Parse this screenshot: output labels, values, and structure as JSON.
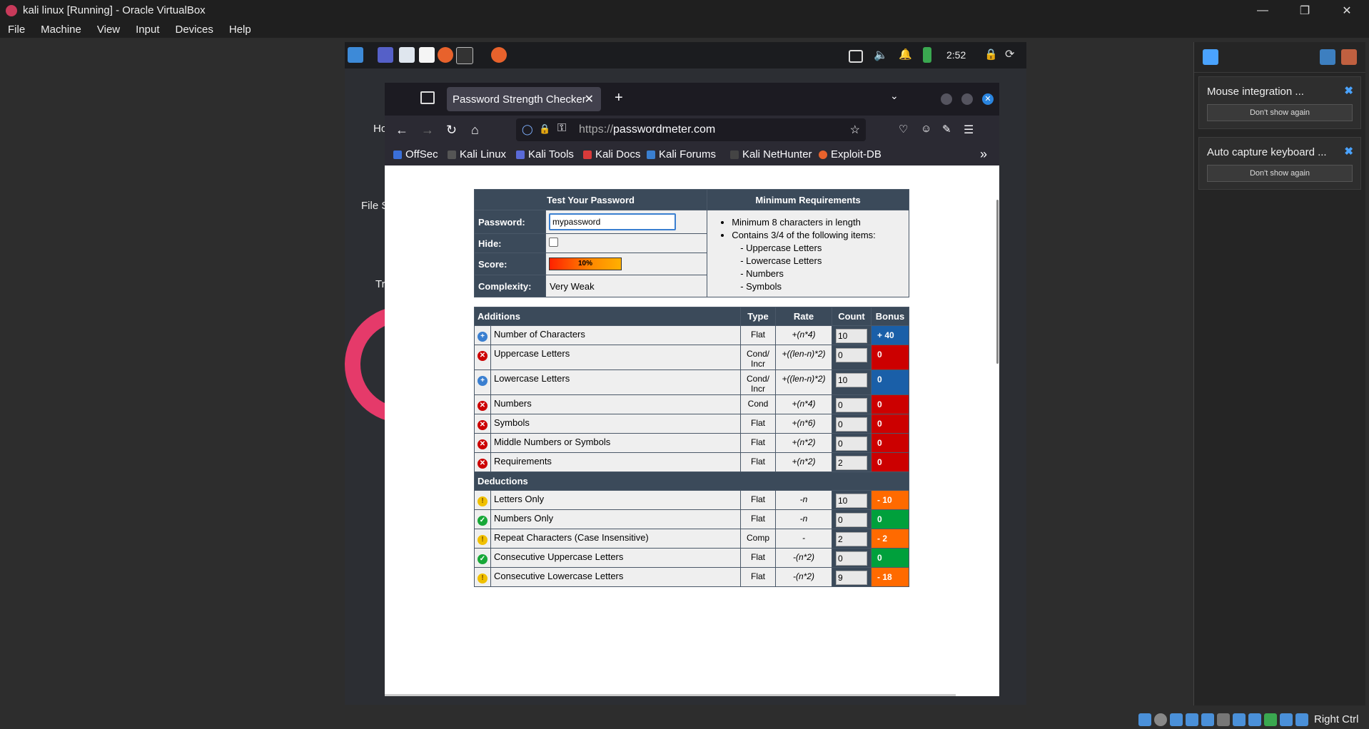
{
  "host": {
    "title": "kali linux [Running] - Oracle VirtualBox",
    "menu": [
      "File",
      "Machine",
      "View",
      "Input",
      "Devices",
      "Help"
    ],
    "status_right": "Right Ctrl"
  },
  "notifications": [
    {
      "title": "Mouse integration ...",
      "button": "Don't show again"
    },
    {
      "title": "Auto capture keyboard ...",
      "button": "Don't show again"
    }
  ],
  "guest": {
    "clock": "2:52",
    "desktop_labels": [
      "Ho",
      "File S",
      "Tr"
    ]
  },
  "browser": {
    "tab_title": "Password Strength Checker",
    "url_scheme": "https://",
    "url_host": "passwordmeter.com",
    "bookmarks": [
      "OffSec",
      "Kali Linux",
      "Kali Tools",
      "Kali Docs",
      "Kali Forums",
      "Kali NetHunter",
      "Exploit-DB"
    ]
  },
  "test": {
    "header": "Test Your Password",
    "password_label": "Password:",
    "password_value": "mypassword",
    "hide_label": "Hide:",
    "score_label": "Score:",
    "score_text": "10%",
    "complexity_label": "Complexity:",
    "complexity_value": "Very Weak"
  },
  "requirements": {
    "header": "Minimum Requirements",
    "items": [
      "Minimum 8 characters in length",
      "Contains 3/4 of the following items:"
    ],
    "subitems": [
      "- Uppercase Letters",
      "- Lowercase Letters",
      "- Numbers",
      "- Symbols"
    ]
  },
  "columns": {
    "additions": "Additions",
    "type": "Type",
    "rate": "Rate",
    "count": "Count",
    "bonus": "Bonus",
    "deductions": "Deductions"
  },
  "additions": [
    {
      "name": "Number of Characters",
      "type": "Flat",
      "rate": "+(n*4)",
      "count": "10",
      "bonus": "+ 40",
      "status": "blue"
    },
    {
      "name": "Uppercase Letters",
      "type": "Cond/ Incr",
      "rate": "+((len-n)*2)",
      "count": "0",
      "bonus": "0",
      "status": "red"
    },
    {
      "name": "Lowercase Letters",
      "type": "Cond/ Incr",
      "rate": "+((len-n)*2)",
      "count": "10",
      "bonus": "0",
      "status": "blue"
    },
    {
      "name": "Numbers",
      "type": "Cond",
      "rate": "+(n*4)",
      "count": "0",
      "bonus": "0",
      "status": "red"
    },
    {
      "name": "Symbols",
      "type": "Flat",
      "rate": "+(n*6)",
      "count": "0",
      "bonus": "0",
      "status": "red"
    },
    {
      "name": "Middle Numbers or Symbols",
      "type": "Flat",
      "rate": "+(n*2)",
      "count": "0",
      "bonus": "0",
      "status": "red"
    },
    {
      "name": "Requirements",
      "type": "Flat",
      "rate": "+(n*2)",
      "count": "2",
      "bonus": "0",
      "status": "red"
    }
  ],
  "deductions": [
    {
      "name": "Letters Only",
      "type": "Flat",
      "rate": "-n",
      "count": "10",
      "bonus": "- 10",
      "status": "warn"
    },
    {
      "name": "Numbers Only",
      "type": "Flat",
      "rate": "-n",
      "count": "0",
      "bonus": "0",
      "status": "ok"
    },
    {
      "name": "Repeat Characters (Case Insensitive)",
      "type": "Comp",
      "rate": "-",
      "count": "2",
      "bonus": "- 2",
      "status": "warn"
    },
    {
      "name": "Consecutive Uppercase Letters",
      "type": "Flat",
      "rate": "-(n*2)",
      "count": "0",
      "bonus": "0",
      "status": "ok"
    },
    {
      "name": "Consecutive Lowercase Letters",
      "type": "Flat",
      "rate": "-(n*2)",
      "count": "9",
      "bonus": "- 18",
      "status": "warn"
    }
  ]
}
